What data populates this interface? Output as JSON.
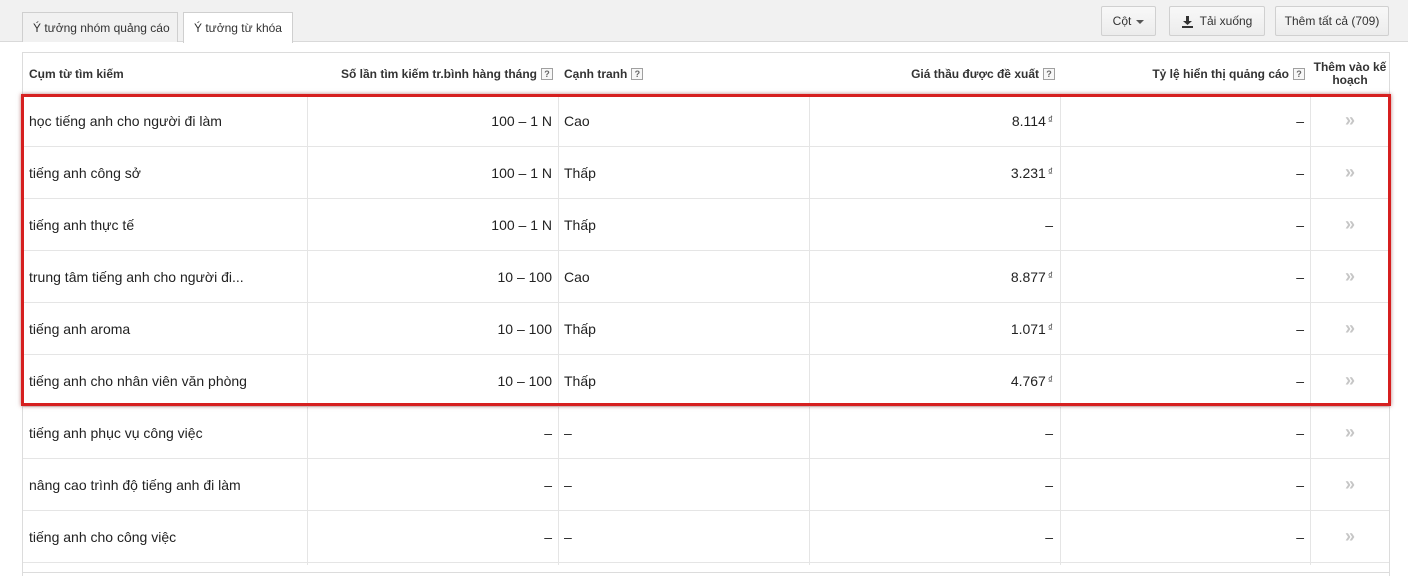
{
  "tabs": [
    {
      "label": "Ý tưởng nhóm quảng cáo",
      "active": false
    },
    {
      "label": "Ý tưởng từ khóa",
      "active": true
    }
  ],
  "toolbar": {
    "columns_label": "Cột",
    "download_label": "Tải xuống",
    "add_all_label": "Thêm tất cả (709)"
  },
  "table": {
    "headers": {
      "keyword": "Cụm từ tìm kiếm",
      "searches": "Số lần tìm kiếm tr.bình hàng tháng",
      "competition": "Cạnh tranh",
      "bid": "Giá thầu được đề xuất",
      "impression_share": "Tỷ lệ hiển thị quảng cáo",
      "add_line1": "Thêm vào kế",
      "add_line2": "hoạch"
    },
    "help_glyph": "?",
    "currency": "₫",
    "add_glyph": "»",
    "rows": [
      {
        "keyword": "học tiếng anh cho người đi làm",
        "searches": "100 – 1 N",
        "competition": "Cao",
        "bid": "8.114",
        "impression_share": "–"
      },
      {
        "keyword": "tiếng anh công sở",
        "searches": "100 – 1 N",
        "competition": "Thấp",
        "bid": "3.231",
        "impression_share": "–"
      },
      {
        "keyword": "tiếng anh thực tế",
        "searches": "100 – 1 N",
        "competition": "Thấp",
        "bid": "–",
        "impression_share": "–"
      },
      {
        "keyword": "trung tâm tiếng anh cho người đi...",
        "searches": "10 – 100",
        "competition": "Cao",
        "bid": "8.877",
        "impression_share": "–"
      },
      {
        "keyword": "tiếng anh aroma",
        "searches": "10 – 100",
        "competition": "Thấp",
        "bid": "1.071",
        "impression_share": "–"
      },
      {
        "keyword": "tiếng anh cho nhân viên văn phòng",
        "searches": "10 – 100",
        "competition": "Thấp",
        "bid": "4.767",
        "impression_share": "–"
      },
      {
        "keyword": "tiếng anh phục vụ công việc",
        "searches": "–",
        "competition": "–",
        "bid": "–",
        "impression_share": "–"
      },
      {
        "keyword": "nâng cao trình độ tiếng anh đi làm",
        "searches": "–",
        "competition": "–",
        "bid": "–",
        "impression_share": "–"
      },
      {
        "keyword": "tiếng anh cho công việc",
        "searches": "–",
        "competition": "–",
        "bid": "–",
        "impression_share": "–"
      }
    ]
  },
  "colors": {
    "highlight_border": "#d61f1f",
    "toolbar_bg": "#f1f1f1",
    "chevron": "#c6c6c6"
  },
  "icons": [
    "caret-down-icon",
    "download-icon",
    "help-icon",
    "add-to-plan-chevron-icon"
  ]
}
